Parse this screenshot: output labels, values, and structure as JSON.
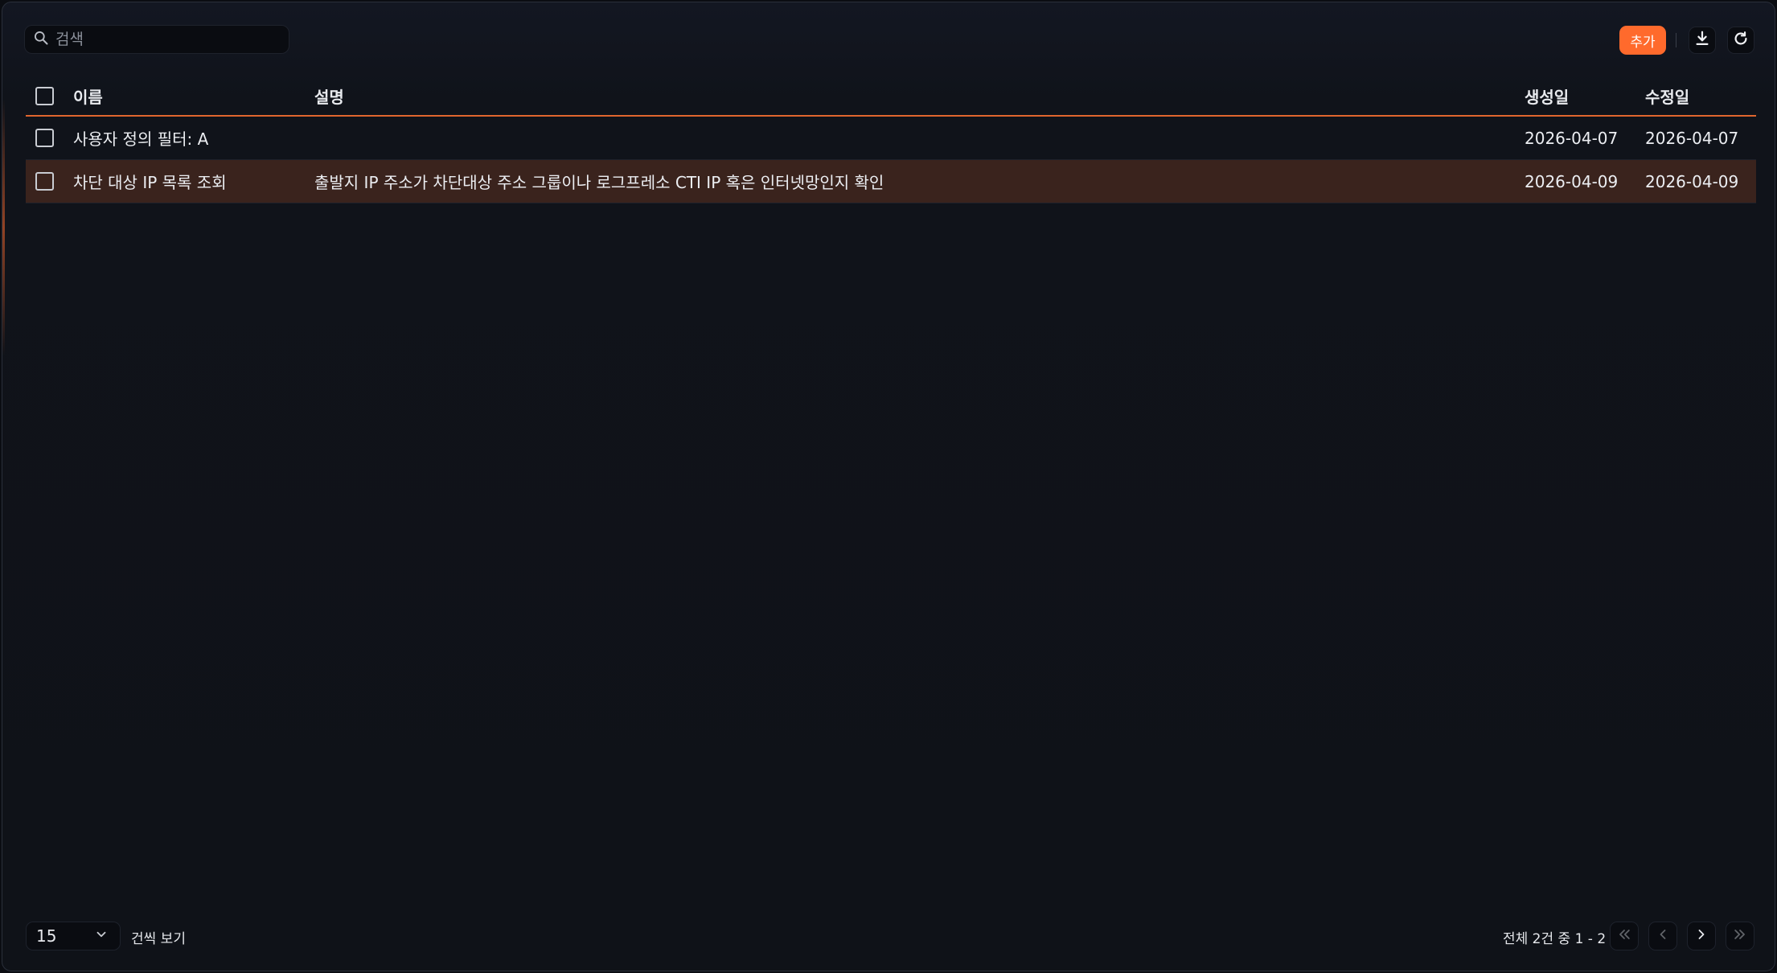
{
  "search": {
    "placeholder": "검색",
    "value": ""
  },
  "toolbar": {
    "add_label": "추가",
    "download_icon": "download-icon",
    "refresh_icon": "refresh-icon"
  },
  "table": {
    "columns": {
      "name": "이름",
      "description": "설명",
      "created": "생성일",
      "updated": "수정일"
    },
    "rows": [
      {
        "name": "사용자 정의 필터: A",
        "description": "",
        "created": "2026-04-07",
        "updated": "2026-04-07",
        "selected": false
      },
      {
        "name": "차단 대상 IP 목록 조회",
        "description": "출발지 IP 주소가 차단대상 주소 그룹이나 로그프레소 CTI IP 혹은 인터넷망인지 확인",
        "created": "2026-04-09",
        "updated": "2026-04-09",
        "selected": true
      }
    ]
  },
  "footer": {
    "page_size": "15",
    "per_page_label": "건씩 보기",
    "page_info": "전체 2건 중 1 - 2"
  },
  "colors": {
    "accent": "#ff6a2c",
    "selected_row": "#3a231d",
    "background": "#0f1218"
  }
}
